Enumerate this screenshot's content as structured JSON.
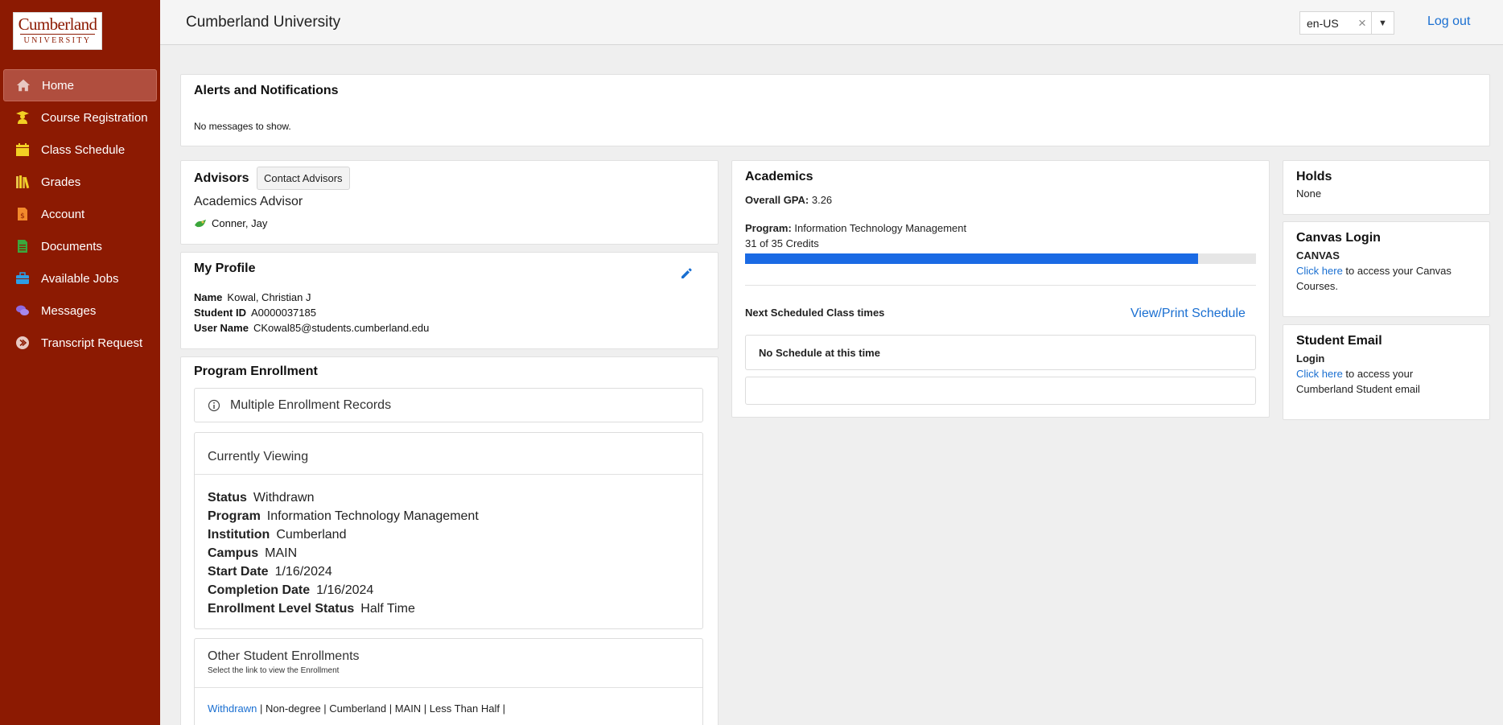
{
  "sidebar": {
    "logo_top": "Cumberland",
    "logo_bottom": "UNIVERSITY",
    "items": [
      {
        "label": "Home",
        "icon": "home-icon"
      },
      {
        "label": "Course Registration",
        "icon": "graduate-icon"
      },
      {
        "label": "Class Schedule",
        "icon": "calendar-icon"
      },
      {
        "label": "Grades",
        "icon": "books-icon"
      },
      {
        "label": "Account",
        "icon": "dollar-document-icon"
      },
      {
        "label": "Documents",
        "icon": "document-icon"
      },
      {
        "label": "Available Jobs",
        "icon": "briefcase-icon"
      },
      {
        "label": "Messages",
        "icon": "chat-icon"
      },
      {
        "label": "Transcript Request",
        "icon": "arrow-circle-icon"
      }
    ]
  },
  "header": {
    "title": "Cumberland University",
    "language": "en-US",
    "logout": "Log out"
  },
  "alerts": {
    "title": "Alerts and Notifications",
    "message": "No messages to show."
  },
  "advisors": {
    "title": "Advisors",
    "contact_button": "Contact Advisors",
    "role": "Academics Advisor",
    "name": "Conner, Jay"
  },
  "profile": {
    "title": "My Profile",
    "name_label": "Name",
    "name": "Kowal, Christian J",
    "id_label": "Student ID",
    "id": "A0000037185",
    "user_label": "User Name",
    "user": "CKowal85@students.cumberland.edu"
  },
  "enrollment": {
    "title": "Program Enrollment",
    "multiple": "Multiple Enrollment Records",
    "viewing_title": "Currently Viewing",
    "rows": [
      {
        "label": "Status",
        "value": "Withdrawn"
      },
      {
        "label": "Program",
        "value": "Information Technology Management"
      },
      {
        "label": "Institution",
        "value": "Cumberland"
      },
      {
        "label": "Campus",
        "value": "MAIN"
      },
      {
        "label": "Start Date",
        "value": "1/16/2024"
      },
      {
        "label": "Completion Date",
        "value": "1/16/2024"
      },
      {
        "label": "Enrollment Level Status",
        "value": "Half Time"
      }
    ],
    "other_title": "Other Student Enrollments",
    "other_sub": "Select the link to view the Enrollment",
    "other_link": "Withdrawn",
    "other_rest": " | Non-degree | Cumberland | MAIN | Less Than Half |"
  },
  "academics": {
    "title": "Academics",
    "gpa_label": "Overall GPA:",
    "gpa": "3.26",
    "program_label": "Program:",
    "program": "Information Technology Management",
    "credits": "31 of 35 Credits",
    "credits_fraction": 0.886,
    "next_label": "Next Scheduled Class times",
    "view_print": "View/Print Schedule",
    "no_schedule": "No Schedule at this time"
  },
  "holds": {
    "title": "Holds",
    "value": "None"
  },
  "canvas": {
    "title": "Canvas Login",
    "sub": "CANVAS",
    "link": "Click here",
    "text1": " to access your Canvas",
    "text2": "Courses."
  },
  "email": {
    "title": "Student Email",
    "sub": "Login",
    "link": "Click here",
    "text1": " to access your",
    "text2": "Cumberland Student email"
  },
  "colors": {
    "sidebar": "#8c1a02",
    "link": "#1a6fd1",
    "progress": "#1a6ae4"
  }
}
